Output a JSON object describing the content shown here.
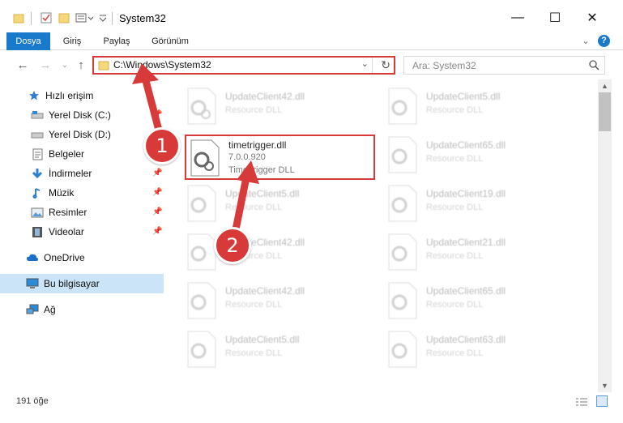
{
  "window": {
    "title": "System32",
    "controls": {
      "minimize": "—",
      "maximize": "☐",
      "close": "✕"
    }
  },
  "ribbon": {
    "tabs": [
      {
        "label": "Dosya",
        "active": true
      },
      {
        "label": "Giriş"
      },
      {
        "label": "Paylaş"
      },
      {
        "label": "Görünüm"
      }
    ]
  },
  "address": {
    "path": "C:\\Windows\\System32",
    "search_placeholder": "Ara: System32"
  },
  "sidebar": {
    "items": [
      {
        "label": "Hızlı erişim",
        "icon": "star-icon"
      },
      {
        "label": "Yerel Disk (C:)",
        "icon": "drive-icon"
      },
      {
        "label": "Yerel Disk (D:)",
        "icon": "drive-icon"
      },
      {
        "label": "Belgeler",
        "icon": "documents-icon"
      },
      {
        "label": "İndirmeler",
        "icon": "download-icon"
      },
      {
        "label": "Müzik",
        "icon": "music-icon"
      },
      {
        "label": "Resimler",
        "icon": "pictures-icon"
      },
      {
        "label": "Videolar",
        "icon": "video-icon"
      },
      {
        "label": "OneDrive",
        "icon": "cloud-icon"
      },
      {
        "label": "Bu bilgisayar",
        "icon": "computer-icon",
        "selected": true
      },
      {
        "label": "Ağ",
        "icon": "network-icon"
      }
    ]
  },
  "files": {
    "main": {
      "name": "timetrigger.dll",
      "version": "7.0.0.920",
      "description": "TimeTrigger DLL"
    },
    "faded_desc": "Resource DLL",
    "left_column": [
      "UpdateClient42.dll",
      "UpdateClient5.dll",
      "UpdateClient42.dll",
      "UpdateClient42.dll",
      "UpdateClient5.dll"
    ],
    "right_column": [
      "UpdateClient5.dll",
      "UpdateClient65.dll",
      "UpdateClient19.dll",
      "UpdateClient21.dll",
      "UpdateClient65.dll",
      "UpdateClient63.dll"
    ]
  },
  "status": {
    "count": "191 öğe"
  },
  "annotations": {
    "step1": "1",
    "step2": "2"
  },
  "colors": {
    "accent": "#1979ca",
    "highlight": "#d83a3a",
    "selected": "#cce4f7"
  }
}
